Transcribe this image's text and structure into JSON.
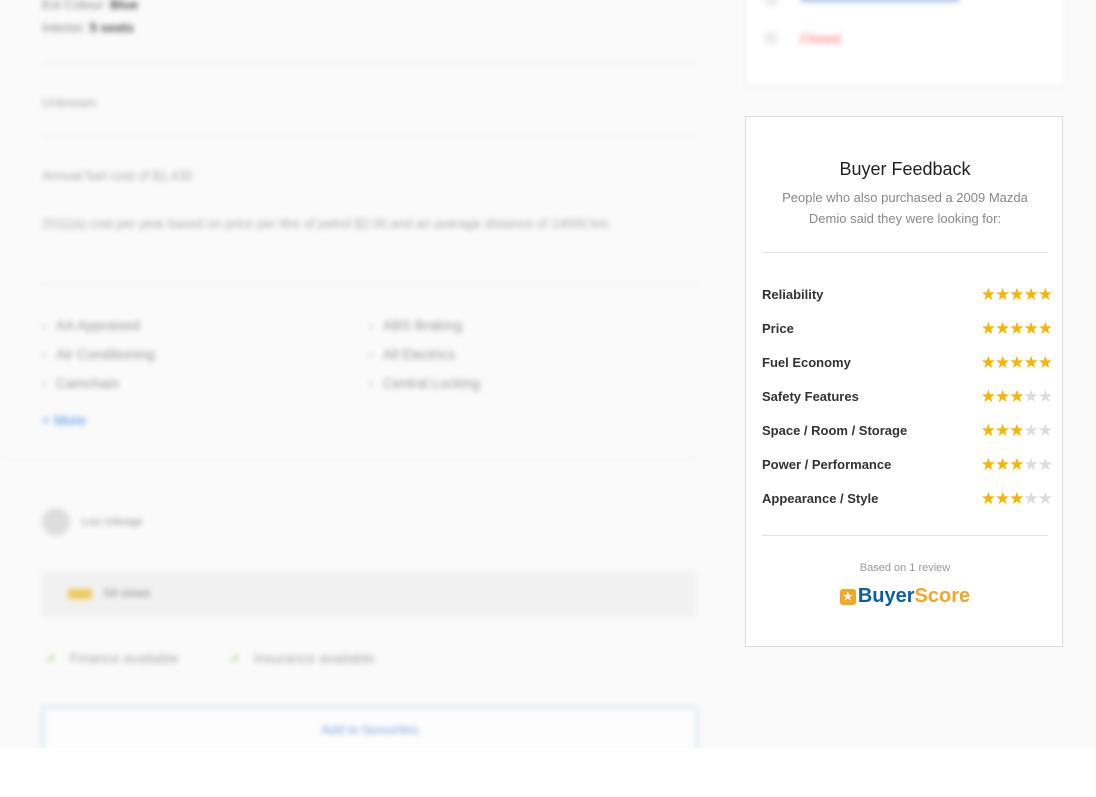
{
  "listing": {
    "ext_colour_label": "Ext Colour:",
    "ext_colour_value": "Blue",
    "interior_label": "Interior:",
    "interior_value": "5 seats",
    "unknown_text": "Unknown",
    "fuel_cost": "Annual fuel cost of $1,430",
    "fuel_note": "2011(a) cost per year based on price per litre of petrol $2.00 and an average distance of 14000 km.",
    "features": [
      "AA Appraised",
      "ABS Braking",
      "Air Conditioning",
      "All Electrics",
      "Camchain",
      "Central Locking"
    ],
    "more_link": "+ More",
    "mileage_label": "Low mileage",
    "views": "54 views",
    "finance": "Finance available",
    "insurance": "Insurance available",
    "favourite_button": "Add to favourites"
  },
  "dealer_card": {
    "status": "Closed"
  },
  "buyer_feedback": {
    "title": "Buyer Feedback",
    "subtitle": "People who also purchased a 2009 Mazda Demio said they were looking for:",
    "ratings": [
      {
        "label": "Reliability",
        "stars": 5
      },
      {
        "label": "Price",
        "stars": 5
      },
      {
        "label": "Fuel Economy",
        "stars": 5
      },
      {
        "label": "Safety Features",
        "stars": 3
      },
      {
        "label": "Space / Room / Storage",
        "stars": 3
      },
      {
        "label": "Power / Performance",
        "stars": 3
      },
      {
        "label": "Appearance / Style",
        "stars": 3
      }
    ],
    "max_stars": 5,
    "based_on": "Based on 1 review",
    "logo_part1": "Buyer",
    "logo_part2": "Score",
    "colors": {
      "star_on": "#f7b500",
      "star_off": "#dcdcdc",
      "logo_blue": "#0b5fa5",
      "logo_orange": "#f5a623"
    }
  }
}
